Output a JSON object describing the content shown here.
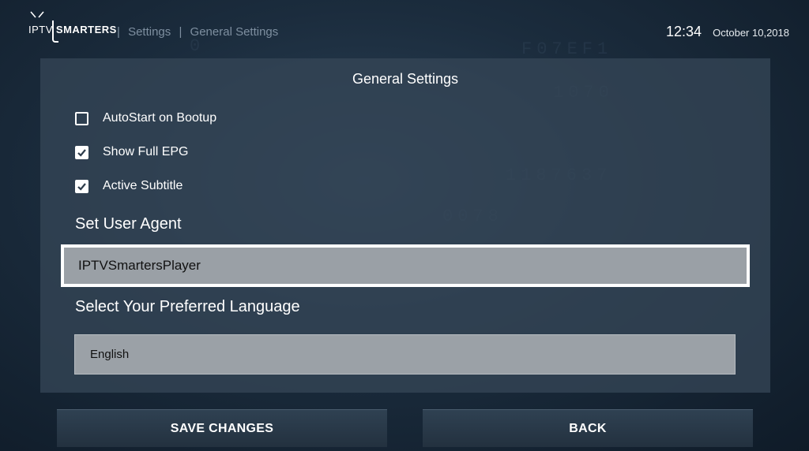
{
  "header": {
    "brand_left": "IPTV",
    "brand_right": "SMARTERS",
    "breadcrumb": [
      "Settings",
      "General Settings"
    ],
    "breadcrumb_separator": "|",
    "time": "12:34",
    "date": "October 10,2018"
  },
  "panel": {
    "title": "General Settings",
    "options": [
      {
        "label": "AutoStart on Bootup",
        "checked": false
      },
      {
        "label": "Show Full EPG",
        "checked": true
      },
      {
        "label": "Active Subtitle",
        "checked": true
      }
    ],
    "user_agent": {
      "label": "Set User Agent",
      "value": "IPTVSmartersPlayer"
    },
    "language": {
      "label": "Select Your Preferred Language",
      "selected": "English"
    }
  },
  "buttons": {
    "save": "SAVE CHANGES",
    "back": "BACK"
  },
  "colors": {
    "panel_bg": "#344556",
    "input_bg": "#9aa0a6",
    "focus_border": "#ffffff"
  }
}
